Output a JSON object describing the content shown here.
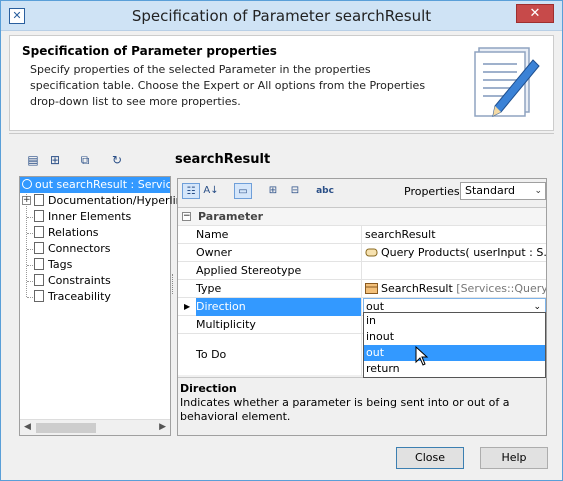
{
  "window": {
    "title": "Specification of Parameter searchResult",
    "close_glyph": "✕"
  },
  "header": {
    "title": "Specification of Parameter properties",
    "description": "Specify properties of the selected Parameter in the properties specification table. Choose the Expert or All options from the Properties drop-down list to see more properties."
  },
  "element_title": "searchResult",
  "tree": {
    "items": [
      {
        "label": "out searchResult : Services"
      },
      {
        "label": "Documentation/Hyperlin"
      },
      {
        "label": "Inner Elements"
      },
      {
        "label": "Relations"
      },
      {
        "label": "Connectors"
      },
      {
        "label": "Tags"
      },
      {
        "label": "Constraints"
      },
      {
        "label": "Traceability"
      }
    ]
  },
  "properties": {
    "label": "Properties:",
    "selected": "Standard"
  },
  "grid": {
    "group": "Parameter",
    "rows": [
      {
        "name": "Name",
        "value": "searchResult"
      },
      {
        "name": "Owner",
        "value": "Query Products( userInput : S..."
      },
      {
        "name": "Applied Stereotype",
        "value": ""
      },
      {
        "name": "Type",
        "value": "SearchResult",
        "value_extra": "[Services::Query..."
      },
      {
        "name": "Direction",
        "value": "out"
      },
      {
        "name": "Multiplicity",
        "value": ""
      },
      {
        "name": "To Do",
        "value": ""
      }
    ]
  },
  "direction_dropdown": {
    "options": [
      "in",
      "inout",
      "out",
      "return"
    ],
    "highlighted": "out"
  },
  "description": {
    "title": "Direction",
    "text": "Indicates whether a parameter is being sent into or out of a behavioral element."
  },
  "buttons": {
    "close": "Close",
    "help": "Help"
  },
  "colors": {
    "selection": "#3399ff",
    "titlebar": "#cfe3f5"
  }
}
